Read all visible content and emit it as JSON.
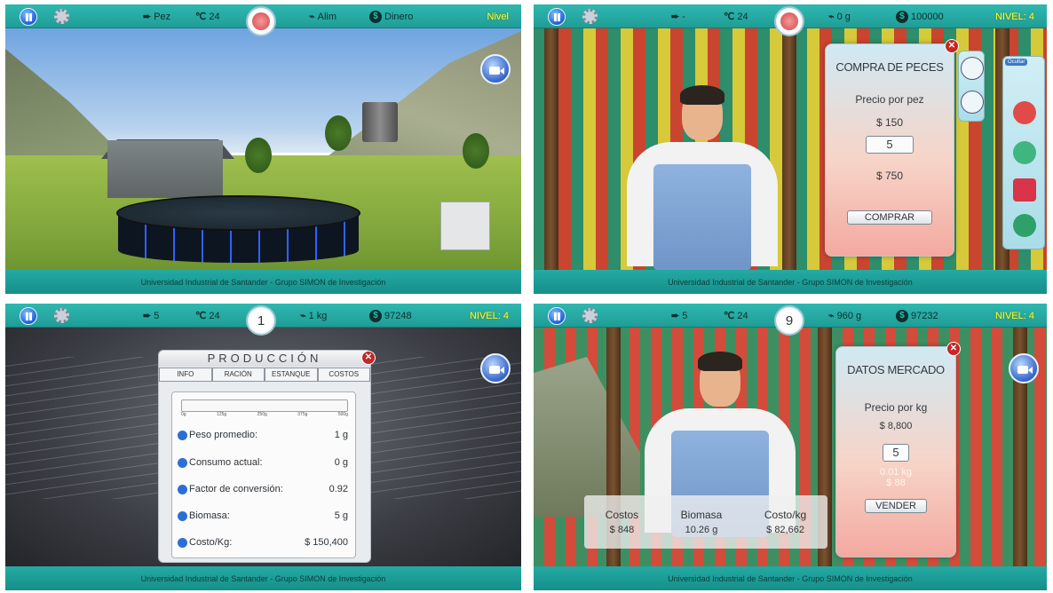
{
  "footer": "Universidad Industrial de Santander - Grupo SIMON de Investigación",
  "panel1": {
    "fish": "Pez",
    "temp": "24",
    "feed": "Alim",
    "money": "Dinero",
    "level": "Nivel"
  },
  "panel2": {
    "fish": "-",
    "temp": "24",
    "feed": "0 g",
    "money": "100000",
    "level": "NIVEL: 4",
    "modal": {
      "title": "COMPRA DE PECES",
      "price_label": "Precio por pez",
      "price": "$ 150",
      "quantity": "5",
      "total": "$ 750",
      "button": "COMPRAR"
    },
    "side_label": "Ocultar"
  },
  "panel3": {
    "fish": "5",
    "temp": "24",
    "feed": "1 kg",
    "money": "97248",
    "level": "NIVEL: 4",
    "badge": "1",
    "title": "PRODUCCIÓN",
    "tabs": [
      "INFO",
      "RACIÓN",
      "ESTANQUE",
      "COSTOS"
    ],
    "ticks": [
      "0g",
      "125g",
      "250g",
      "375g",
      "500g"
    ],
    "rows": [
      {
        "label": "Peso promedio:",
        "value": "1 g"
      },
      {
        "label": "Consumo actual:",
        "value": "0 g"
      },
      {
        "label": "Factor de conversión:",
        "value": "0.92"
      },
      {
        "label": "Biomasa:",
        "value": "5 g"
      },
      {
        "label": "Costo/Kg:",
        "value": "$ 150,400"
      }
    ]
  },
  "panel4": {
    "fish": "5",
    "temp": "24",
    "feed": "960 g",
    "money": "97232",
    "level": "NIVEL: 4",
    "badge": "9",
    "modal": {
      "title": "DATOS MERCADO",
      "price_label": "Precio por kg",
      "price": "$ 8,800",
      "quantity": "5",
      "kg": "0.01 kg",
      "amount": "$ 88",
      "button": "VENDER"
    },
    "stats": [
      {
        "label": "Costos",
        "value": "$ 848"
      },
      {
        "label": "Biomasa",
        "value": "10.26 g"
      },
      {
        "label": "Costo/kg",
        "value": "$ 82,662"
      }
    ]
  }
}
